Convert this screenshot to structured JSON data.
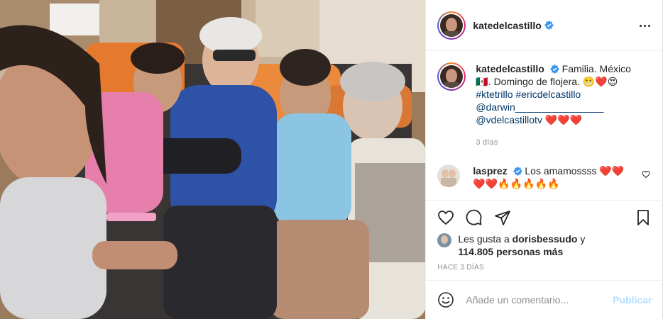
{
  "post": {
    "username": "katedelcastillo",
    "more_label": "More options",
    "caption": {
      "username": "katedelcastillo",
      "text": "Familia. México 🇲🇽. Domingo de flojera. 😬❤️😍",
      "hashtag_1": "#ktetrillo",
      "hashtag_2": "#ericdelcastillo",
      "mention_1": "@darwin________________",
      "mention_2": "@vdelcastillotv",
      "mention_2_suffix": " ❤️❤️❤️"
    },
    "caption_time": "3 días",
    "comment": {
      "username": "lasprez",
      "text": "Los amamossss ❤️❤️ ❤️❤️🔥🔥🔥🔥🔥"
    },
    "likes": {
      "prefix": "Les gusta a ",
      "user": "dorisbessudo",
      "middle": " y",
      "count": "114.805 personas más"
    },
    "posted": "HACE 3 DÍAS",
    "add_comment": {
      "placeholder": "Añade un comentario...",
      "publish_label": "Publicar"
    }
  },
  "colors": {
    "verified": "#3897f0",
    "link": "#00376b",
    "muted": "#8e8e8e",
    "publish_disabled": "#b2dffc"
  },
  "icons": [
    "verified-badge-icon",
    "more-icon",
    "heart-icon",
    "comment-icon",
    "share-icon",
    "save-icon",
    "emoji-icon"
  ]
}
